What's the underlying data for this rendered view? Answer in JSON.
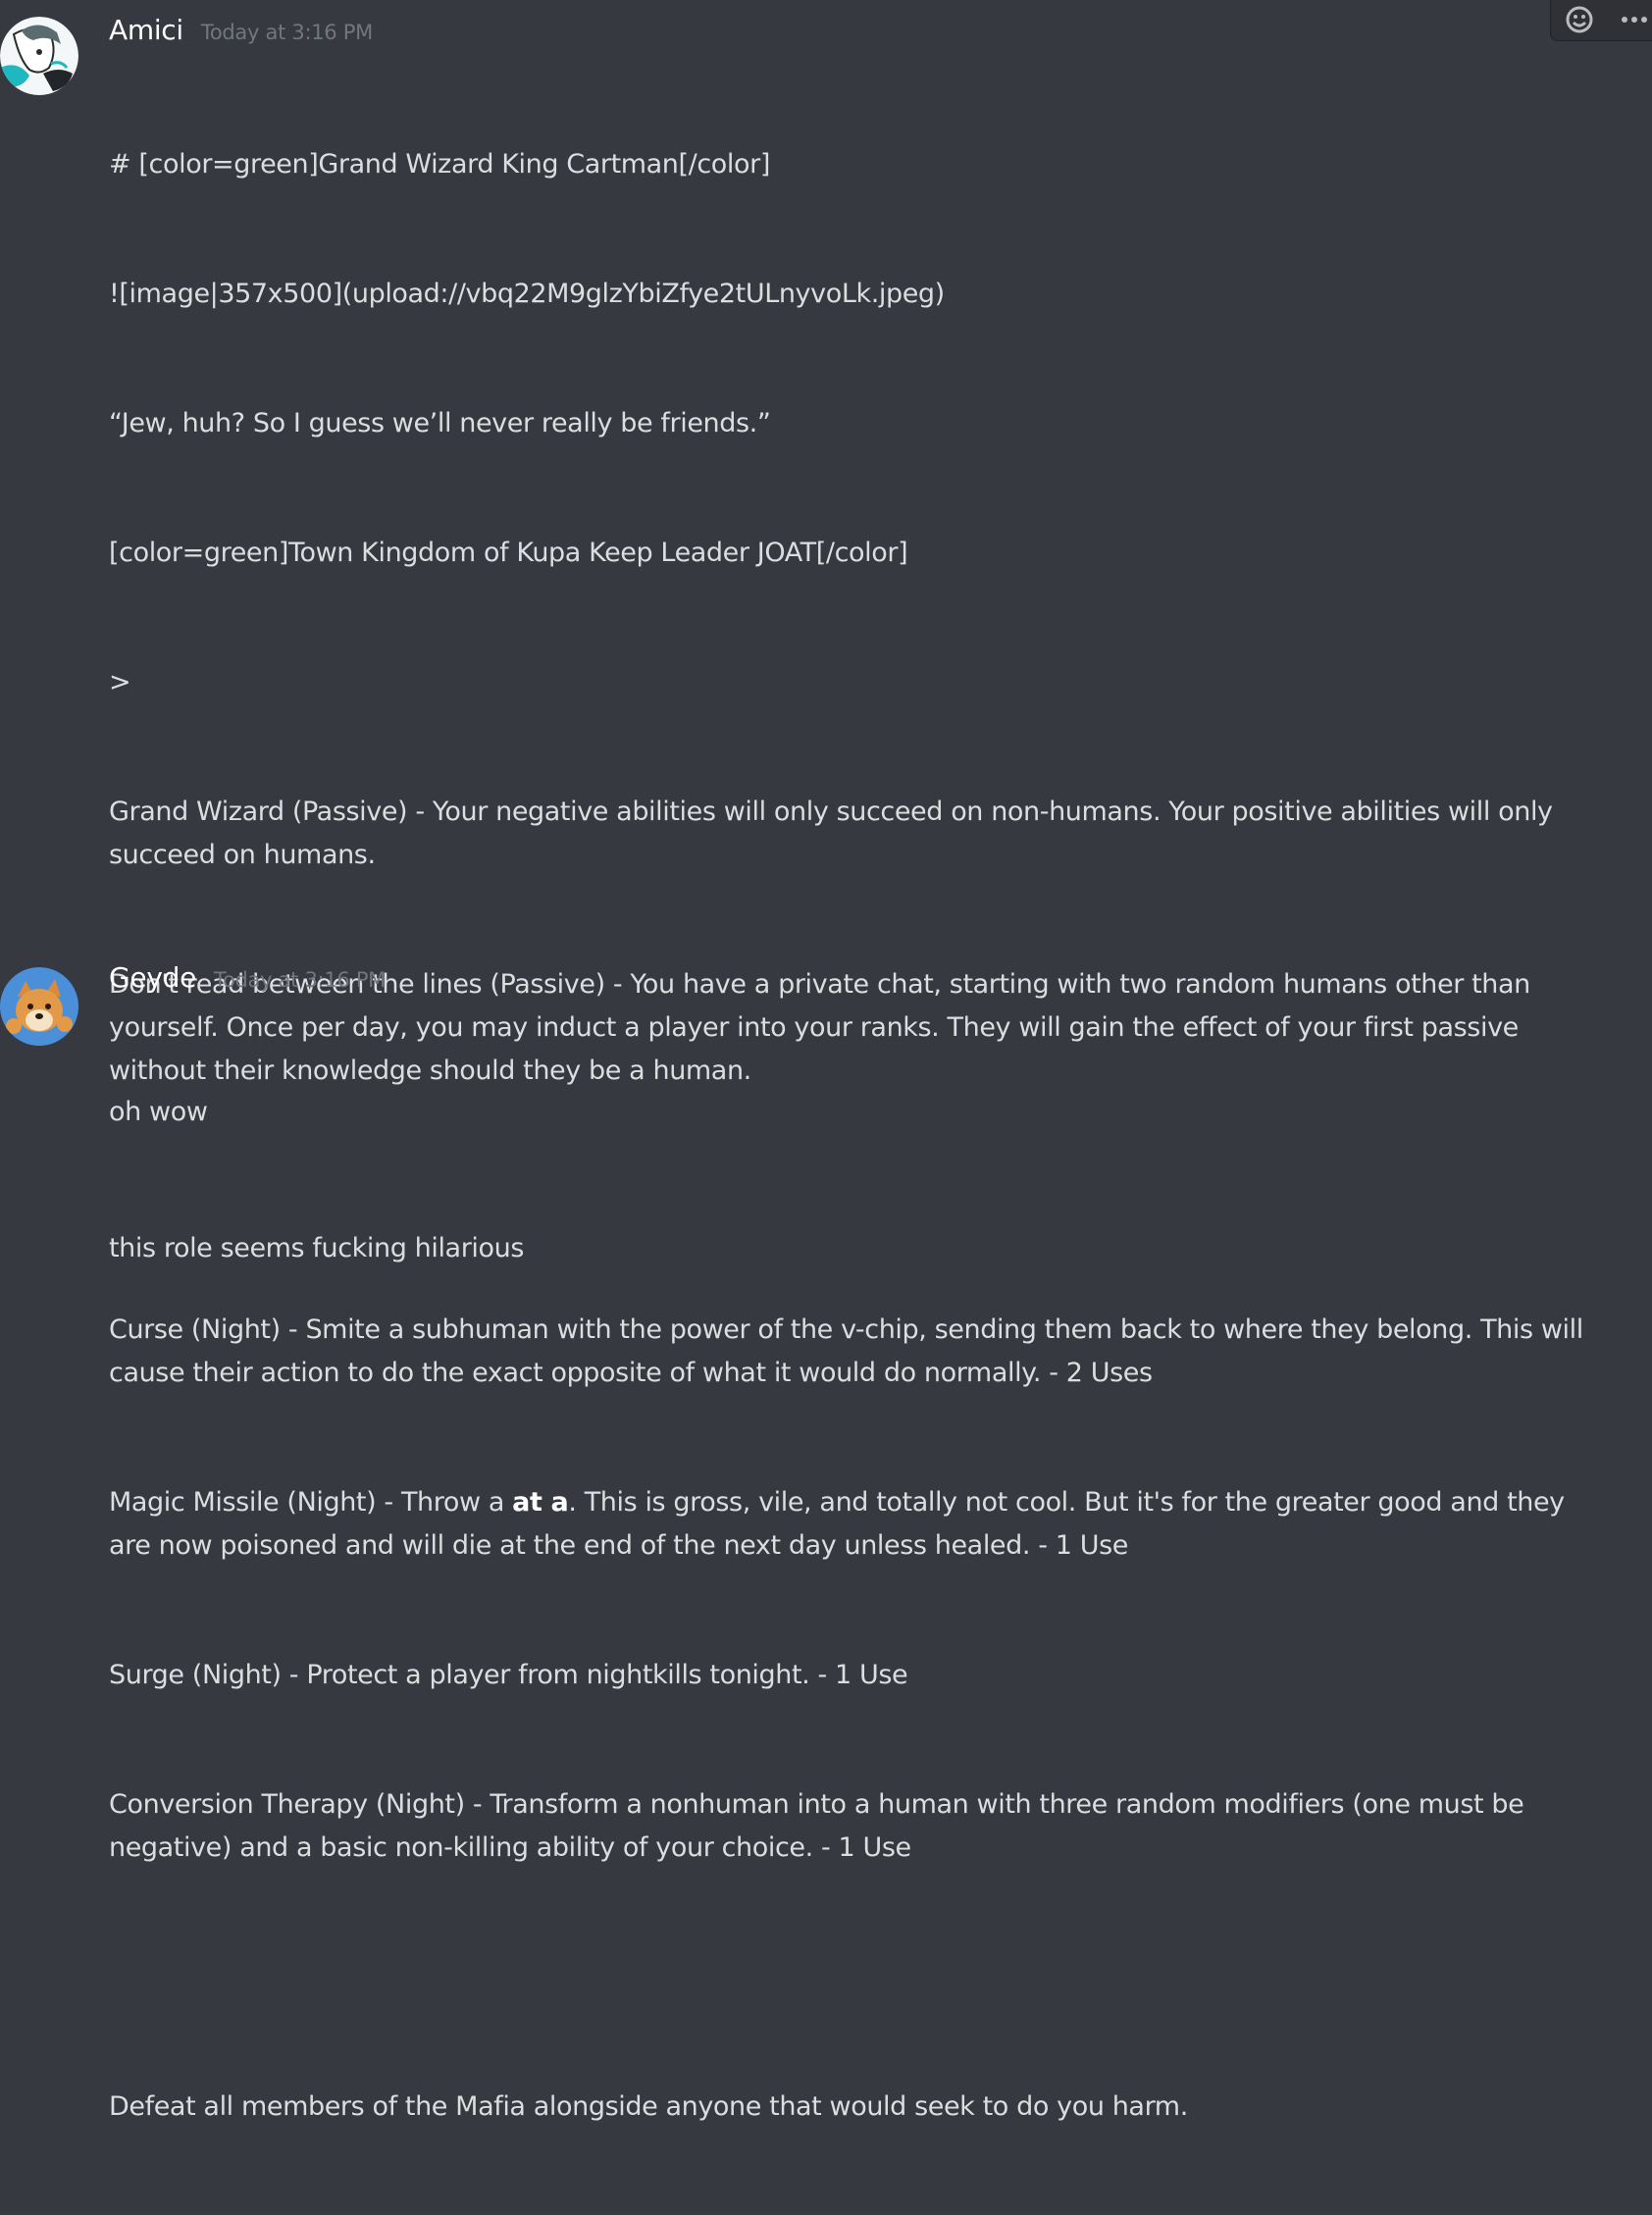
{
  "messages": [
    {
      "author": "Amici",
      "timestamp": "Today at 3:16 PM",
      "lines": {
        "l1": "# [color=green]Grand Wizard King Cartman[/color]",
        "l2": "![image|357x500](upload://vbq22M9glzYbiZfye2tULnyvoLk.jpeg)",
        "l3": "“Jew, huh? So I guess we’ll never really be friends.”",
        "l4": "[color=green]Town Kingdom of Kupa Keep Leader JOAT[/color]",
        "l5": ">",
        "l6": "Grand Wizard (Passive) - Your negative abilities will only succeed on non-humans. Your positive abilities will only succeed on humans.",
        "l7": "Don't read between the lines (Passive) - You have a private chat, starting with two random humans other than yourself. Once per day, you may induct a player into your ranks. They will gain the effect of your first passive without their knowledge should they be a human.",
        "l8": "Curse (Night) - Smite a subhuman with the power of the v-chip, sending them back to where they belong. This will cause their action to do the exact opposite of what it would do normally. - 2 Uses",
        "l9a": "Magic Missile (Night) - Throw a ",
        "l9b": "at a",
        "l9c": ". This is gross, vile, and totally not cool. But it's for the greater good and they are now poisoned and will die at the end of the next day unless healed. - 1 Use",
        "l10": "Surge (Night) - Protect a player from nightkills tonight. - 1 Use",
        "l11": "Conversion Therapy (Night) - Transform a nonhuman into a human with three random modifiers (one must be negative) and a basic non-killing ability of your choice. - 1 Use",
        "l12": "Defeat all members of the Mafia alongside anyone that would seek to do you harm."
      }
    },
    {
      "author": "Geyde",
      "timestamp": "Today at 3:16 PM",
      "lines": {
        "l1": "oh wow",
        "l2": "this role seems fucking hilarious"
      }
    }
  ],
  "icons": {
    "add_reaction": "add-reaction-icon",
    "more": "more-options-icon"
  },
  "colors": {
    "background": "#36393f",
    "text": "#dcddde",
    "username": "#ffffff",
    "timestamp": "#72767d"
  }
}
